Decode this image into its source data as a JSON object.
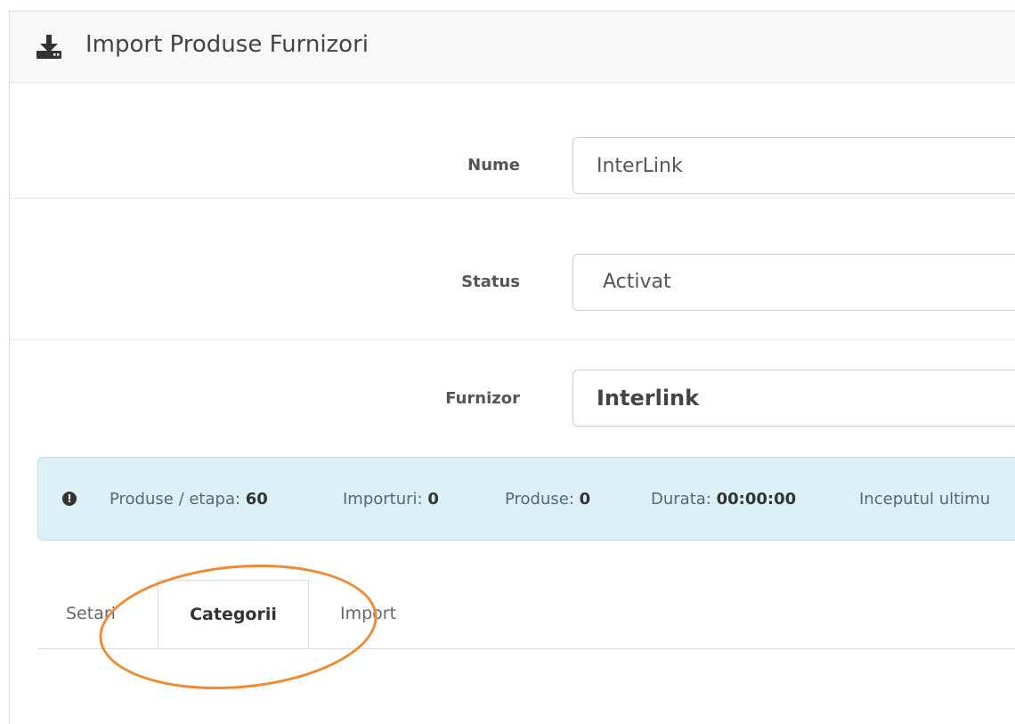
{
  "header": {
    "title": "Import Produse Furnizori",
    "icon": "download-icon"
  },
  "form": {
    "nume": {
      "label": "Nume",
      "value": "InterLink"
    },
    "status": {
      "label": "Status",
      "value": "Activat"
    },
    "furnizor": {
      "label": "Furnizor",
      "value": "Interlink"
    }
  },
  "info": {
    "icon": "exclamation-circle-icon",
    "stats": [
      {
        "label": "Produse / etapa:",
        "value": "60"
      },
      {
        "label": "Importuri:",
        "value": "0"
      },
      {
        "label": "Produse:",
        "value": "0"
      },
      {
        "label": "Durata:",
        "value": "00:00:00"
      },
      {
        "label": "Inceputul ultimu",
        "value": ""
      }
    ]
  },
  "tabs": [
    {
      "label": "Setari",
      "active": false
    },
    {
      "label": "Categorii",
      "active": true
    },
    {
      "label": "Import",
      "active": false
    }
  ],
  "colors": {
    "accent_annotation": "#f08a32",
    "alert_bg": "#dcf0f7"
  }
}
